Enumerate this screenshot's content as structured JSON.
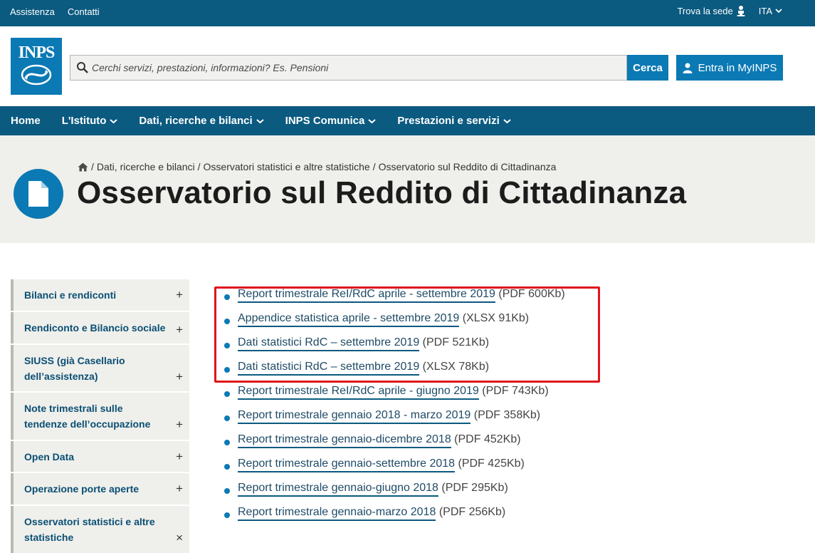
{
  "topbar": {
    "links": [
      "Assistenza",
      "Contatti"
    ],
    "trova_sede": "Trova la sede",
    "language": "ITA"
  },
  "header": {
    "logo_text": "INPS",
    "search_placeholder": "Cerchi servizi, prestazioni, informazioni? Es. Pensioni",
    "search_button": "Cerca",
    "login_button": "Entra in MyINPS"
  },
  "nav": {
    "items": [
      "Home",
      "L'Istituto",
      "Dati, ricerche e bilanci",
      "INPS Comunica",
      "Prestazioni e servizi"
    ]
  },
  "breadcrumb": {
    "items": [
      "Dati, ricerche e bilanci",
      "Osservatori statistici e altre statistiche",
      "Osservatorio sul Reddito di Cittadinanza"
    ],
    "separator": "/"
  },
  "page": {
    "title": "Osservatorio sul Reddito di Cittadinanza"
  },
  "sidebar": {
    "items": [
      {
        "label": "Bilanci e rendiconti",
        "sign": "+"
      },
      {
        "label": "Rendiconto e Bilancio sociale",
        "sign": "+"
      },
      {
        "label": "SIUSS (già Casellario dell’assistenza)",
        "sign": "+"
      },
      {
        "label": "Note trimestrali sulle tendenze dell’occupazione",
        "sign": "+"
      },
      {
        "label": "Open Data",
        "sign": "+"
      },
      {
        "label": "Operazione porte aperte",
        "sign": "+"
      },
      {
        "label": "Osservatori statistici e altre statistiche",
        "sign": "×"
      }
    ]
  },
  "documents": [
    {
      "title": "Report trimestrale ReI/RdC aprile - settembre 2019",
      "meta": "(PDF 600Kb)"
    },
    {
      "title": "Appendice statistica aprile - settembre 2019",
      "meta": "(XLSX 91Kb)"
    },
    {
      "title": "Dati statistici RdC – settembre 2019",
      "meta": "(PDF 521Kb)"
    },
    {
      "title": "Dati statistici RdC – settembre 2019",
      "meta": "(XLSX 78Kb)"
    },
    {
      "title": "Report trimestrale ReI/RdC aprile - giugno 2019",
      "meta": "(PDF 743Kb)"
    },
    {
      "title": "Report trimestrale gennaio 2018 - marzo 2019",
      "meta": "(PDF 358Kb)"
    },
    {
      "title": "Report trimestrale gennaio-dicembre 2018",
      "meta": "(PDF 452Kb)"
    },
    {
      "title": "Report trimestrale gennaio-settembre 2018",
      "meta": "(PDF 425Kb)"
    },
    {
      "title": "Report trimestrale gennaio-giugno 2018",
      "meta": "(PDF 295Kb)"
    },
    {
      "title": "Report trimestrale gennaio-marzo 2018",
      "meta": "(PDF 256Kb)"
    }
  ],
  "colors": {
    "brand_dark": "#0b5a80",
    "brand": "#0b79b4",
    "band_bg": "#efefeb",
    "highlight": "#e0141b"
  }
}
